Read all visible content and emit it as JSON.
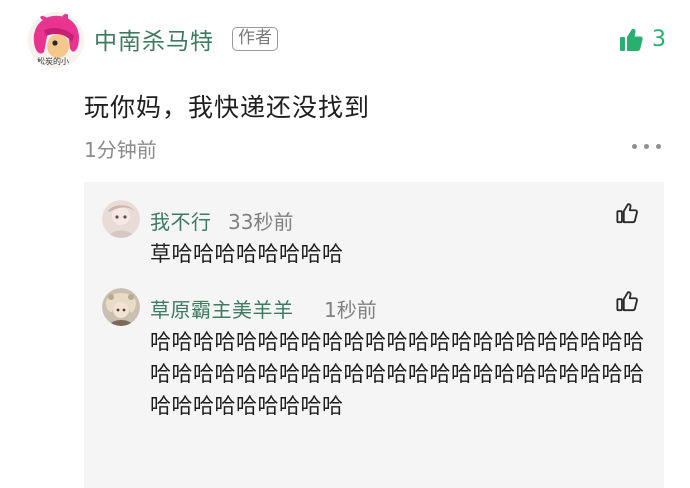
{
  "comment": {
    "author": "中南杀马特",
    "author_badge": "作者",
    "avatar_watermark": "松炭的小",
    "text": "玩你妈，我快递还没找到",
    "time": "1分钟前",
    "like_count": "3"
  },
  "replies": [
    {
      "name": "我不行",
      "time": "33秒前",
      "text": "草哈哈哈哈哈哈哈哈"
    },
    {
      "name": "草原霸主美羊羊",
      "time": "1秒前",
      "text": "哈哈哈哈哈哈哈哈哈哈哈哈哈哈哈哈哈哈哈哈哈哈哈哈哈哈哈哈哈哈哈哈哈哈哈哈哈哈哈哈哈哈哈哈哈哈哈哈哈哈哈哈哈哈哈"
    }
  ],
  "colors": {
    "username": "#3d7a62",
    "like_active": "#27b06e",
    "reply_bg": "#f5f5f5",
    "meta_text": "#8b8b8b"
  },
  "icons": {
    "like_active": "thumbs-up-filled-icon",
    "reply_like": "thumbs-up-outline-icon",
    "more": "more-dots-icon"
  }
}
